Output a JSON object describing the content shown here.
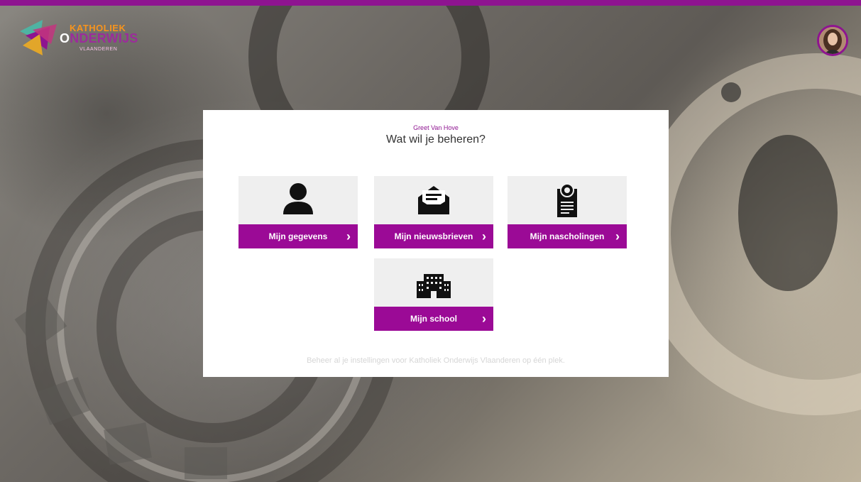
{
  "brand": {
    "line1": "KATHOLIEK",
    "line2_first": "O",
    "line2_rest": "NDERWIJS",
    "line3": "VLAANDEREN",
    "accent_color": "#8e1490"
  },
  "user": {
    "name": "Greet Van Hove"
  },
  "main": {
    "question": "Wat wil je beheren?",
    "tiles": [
      {
        "label": "Mijn gegevens",
        "icon": "person-icon"
      },
      {
        "label": "Mijn nieuwsbrieven",
        "icon": "envelope-icon"
      },
      {
        "label": "Mijn nascholingen",
        "icon": "certificate-icon"
      },
      {
        "label": "Mijn school",
        "icon": "school-building-icon"
      }
    ],
    "chevron": "›",
    "footer": "Beheer al je instellingen voor Katholiek Onderwijs Vlaanderen op één plek."
  }
}
